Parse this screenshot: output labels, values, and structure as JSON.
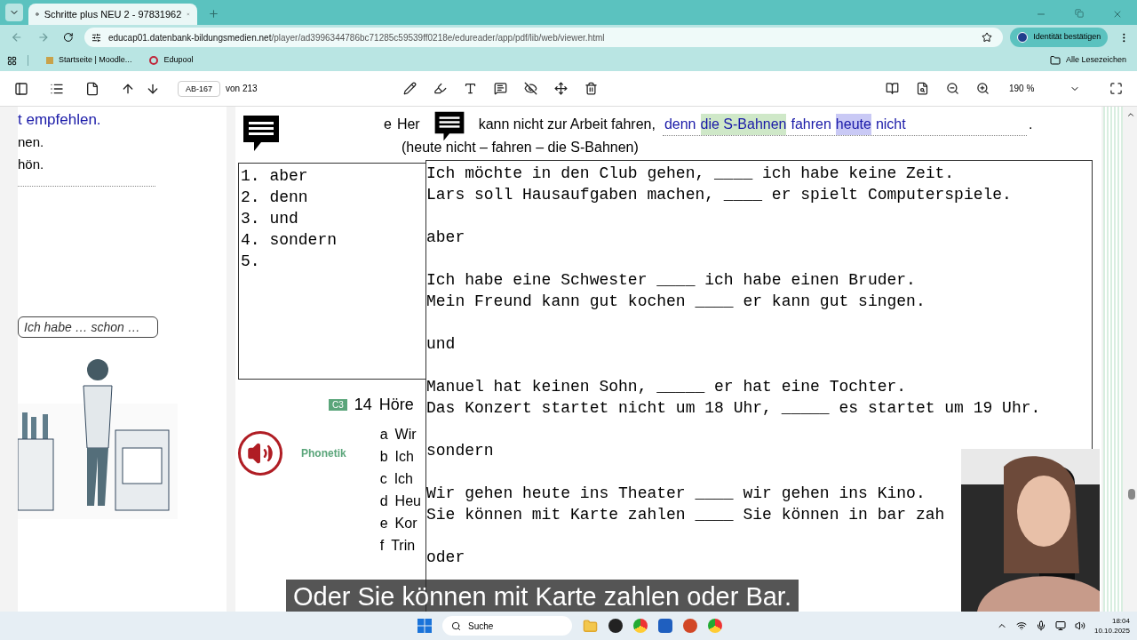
{
  "browser": {
    "tab_title": "Schritte plus NEU 2 - 97831962",
    "url_host": "educap01.datenbank-bildungsmedien.net",
    "url_path": "/player/ad3996344786bc71285c59539ff0218e/edureader/app/pdf/lib/web/viewer.html",
    "identity_button": "Identität bestätigen",
    "bookmarks": [
      "Startseite | Moodle...",
      "Edupool"
    ],
    "all_bookmarks": "Alle Lesezeichen"
  },
  "pdf_toolbar": {
    "page_field": "AB-167",
    "page_count": "von 213",
    "zoom": "190 %"
  },
  "left_page": {
    "lines": [
      "t empfehlen.",
      "nen.",
      "hön."
    ],
    "speech_bubble": "Ich habe … schon …"
  },
  "right_page": {
    "exercise": {
      "letter": "e",
      "start": "Her",
      "rest": "kann nicht zur Arbeit fahren,",
      "answer": [
        {
          "text": "denn",
          "highlighted": false
        },
        {
          "text": "die S-Bahnen",
          "highlighted": true,
          "color": "#cfe8c8"
        },
        {
          "text": "fahren",
          "highlighted": false
        },
        {
          "text": "heute",
          "highlighted": true,
          "color": "#c9c9f5"
        },
        {
          "text": "nicht",
          "highlighted": false
        }
      ],
      "end": ".",
      "hint": "(heute nicht – fahren – die S-Bahnen)"
    },
    "section": {
      "badge": "C3",
      "number": "14",
      "title": "Höre",
      "label": "Phonetik",
      "items": [
        {
          "letter": "a",
          "text": "Wir"
        },
        {
          "letter": "b",
          "text": "Ich"
        },
        {
          "letter": "c",
          "text": "Ich"
        },
        {
          "letter": "d",
          "text": "Heu"
        },
        {
          "letter": "e",
          "text": "Kor"
        },
        {
          "letter": "f",
          "text": "Trin"
        }
      ]
    }
  },
  "notes": {
    "list": [
      "1. aber",
      "2. denn",
      "3. und",
      "4. sondern",
      "5."
    ],
    "blocks": [
      [
        "Ich möchte in den Club gehen, ____ ich habe keine Zeit.",
        "Lars soll Hausaufgaben machen, ____ er spielt Computerspiele."
      ],
      [
        "aber"
      ],
      [
        "Ich habe eine Schwester ____ ich habe einen Bruder.",
        "Mein Freund kann gut kochen ____ er kann gut singen."
      ],
      [
        "und"
      ],
      [
        "Manuel hat keinen Sohn, _____ er hat eine Tochter.",
        "Das Konzert startet nicht um 18 Uhr, _____ es startet um 19 Uhr."
      ],
      [
        "sondern"
      ],
      [
        "Wir gehen heute ins Theater ____ wir gehen ins Kino.",
        "Sie können mit Karte zahlen ____ Sie können in bar zah"
      ],
      [
        "oder"
      ]
    ]
  },
  "subtitle": "Oder Sie können mit Karte zahlen oder Bar.",
  "taskbar": {
    "search": "Suche",
    "time": "18:04",
    "date": "10.10.2025"
  }
}
